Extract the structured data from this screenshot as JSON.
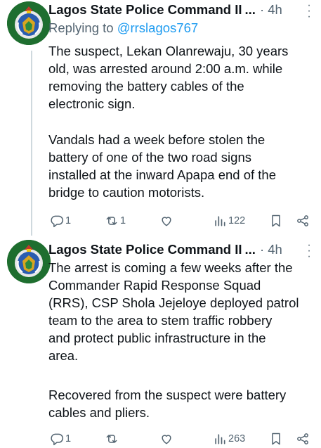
{
  "tweets": [
    {
      "author_name": "Lagos State Police Command II",
      "ellipsis": "...",
      "time": "· 4h",
      "replying_prefix": "Replying to ",
      "replying_handle": "@rrslagos767",
      "paragraph_1": "The suspect, Lekan Olanrewaju, 30 years\nold, was arrested around 2:00 a.m. while\nremoving the battery cables of the\nelectronic sign.",
      "paragraph_2": "Vandals had a week before stolen the\nbattery of one of the two road signs\ninstalled at the inward Apapa end of the\nbridge to caution motorists.",
      "reply_count": "1",
      "repost_count": "1",
      "like_count": "",
      "view_count": "122"
    },
    {
      "author_name": "Lagos State Police Command II",
      "ellipsis": "...",
      "time": "· 4h",
      "paragraph_1": "The arrest is coming a few weeks after the\nCommander Rapid Response Squad\n(RRS), CSP Shola Jejeloye deployed patrol\nteam to the area to stem traffic robbery\nand protect public infrastructure in the\narea.",
      "paragraph_2": "Recovered from the suspect were battery\ncables and pliers.",
      "reply_count": "1",
      "repost_count": "",
      "like_count": "",
      "view_count": "263"
    }
  ],
  "colors": {
    "text": "#0f1419",
    "secondary": "#536471",
    "link": "#1d9bf0",
    "thread_line": "#cfd9de"
  },
  "icons": [
    "reply-icon",
    "repost-icon",
    "like-icon",
    "views-icon",
    "bookmark-icon",
    "share-icon",
    "more-icon"
  ]
}
